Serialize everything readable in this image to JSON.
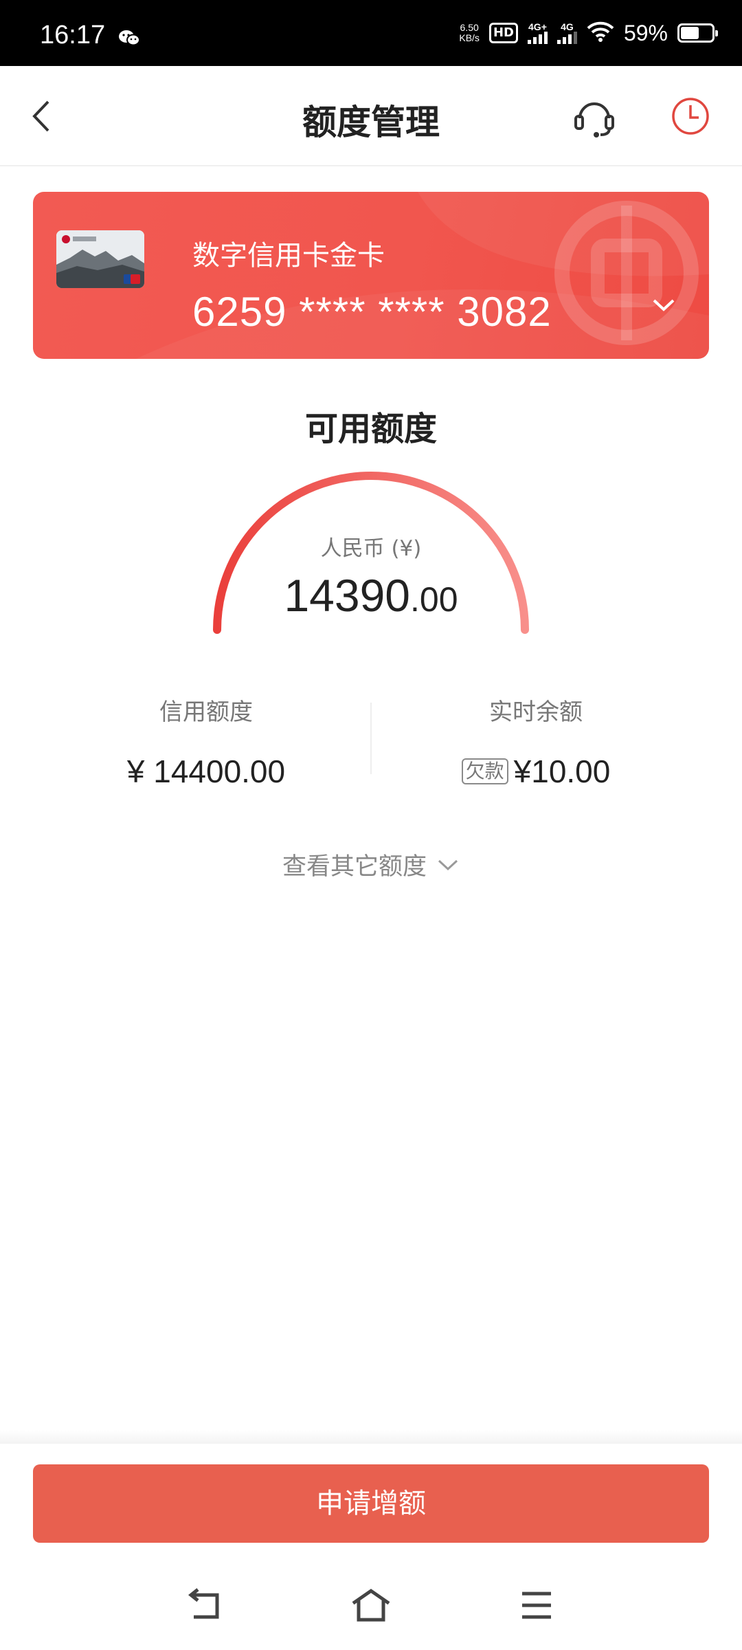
{
  "status_bar": {
    "time": "16:17",
    "net_speed_value": "6.50",
    "net_speed_unit": "KB/s",
    "hd_label": "HD",
    "signal1_label": "4G+",
    "signal2_label": "4G",
    "battery_percent": "59%",
    "battery_level": 0.59
  },
  "header": {
    "title": "额度管理",
    "back_icon": "chevron-left-icon",
    "support_icon": "headset-icon",
    "history_icon": "clock-icon"
  },
  "card": {
    "name": "数字信用卡金卡",
    "number": "6259 **** **** 3082",
    "color": "#f1564e"
  },
  "available": {
    "title": "可用额度",
    "currency_label": "人民币 (¥)",
    "amount_integer": "14390",
    "amount_decimal": ".00"
  },
  "credit_limit": {
    "label": "信用额度",
    "value": "¥ 14400.00"
  },
  "balance": {
    "label": "实时余额",
    "tag": "欠款",
    "value": "¥10.00"
  },
  "more_link": {
    "label": "查看其它额度"
  },
  "apply_button": {
    "label": "申请增额",
    "color": "#e8604f"
  },
  "nav_bar": {
    "icons": [
      "back-icon",
      "home-icon",
      "menu-icon"
    ]
  }
}
